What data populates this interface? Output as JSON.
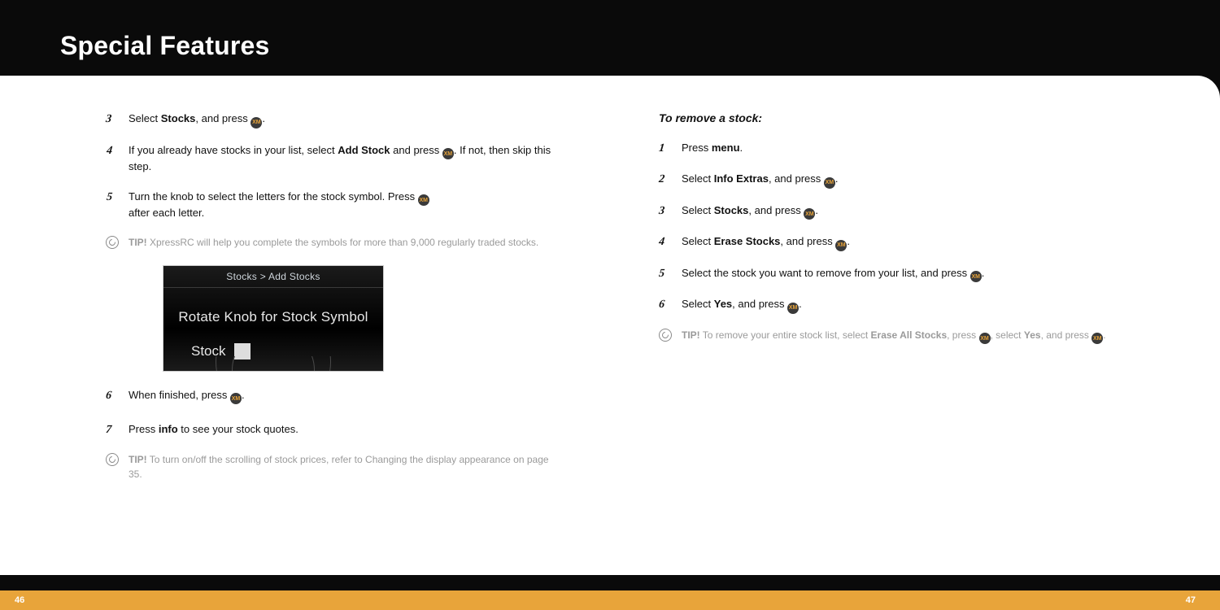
{
  "header": {
    "title": "Special Features"
  },
  "left": {
    "steps": {
      "s3": {
        "num": "3",
        "pre": "Select ",
        "bold": "Stocks",
        "post": ", and press "
      },
      "s4": {
        "num": "4",
        "pre": "If you already have stocks in your list, select ",
        "bold": "Add Stock",
        "post": " and press ",
        "tail": ". If not, then skip this step."
      },
      "s5": {
        "num": "5",
        "line1": "Turn the knob to select the letters for the stock symbol. Press ",
        "line2": "after each letter."
      },
      "s6": {
        "num": "6",
        "pre": "When finished, press "
      },
      "s7": {
        "num": "7",
        "pre": "Press ",
        "bold": "info",
        "post": " to see your stock quotes."
      }
    },
    "tip1": {
      "label": "TIP!",
      "text": " XpressRC will help you complete the symbols for more than 9,000 regularly traded stocks."
    },
    "tip2": {
      "label": "TIP!",
      "text": " To turn on/off the scrolling of stock prices, refer to Changing the display appearance on page 35."
    },
    "screenshot": {
      "title": "Stocks > Add Stocks",
      "main": "Rotate Knob for Stock Symbol",
      "stock_label": "Stock"
    }
  },
  "right": {
    "subhead": "To remove a stock:",
    "steps": {
      "s1": {
        "num": "1",
        "pre": "Press ",
        "bold": "menu",
        "post": "."
      },
      "s2": {
        "num": "2",
        "pre": "Select ",
        "bold": "Info Extras",
        "post": ", and press "
      },
      "s3": {
        "num": "3",
        "pre": "Select ",
        "bold": "Stocks",
        "post": ", and press "
      },
      "s4": {
        "num": "4",
        "pre": "Select ",
        "bold": "Erase Stocks",
        "post": ", and press "
      },
      "s5": {
        "num": "5",
        "text": "Select the stock you want to remove from your list, and press "
      },
      "s6": {
        "num": "6",
        "pre": "Select ",
        "bold": "Yes",
        "post": ", and press "
      }
    },
    "tip": {
      "label": "TIP!",
      "t1": " To remove your entire stock list, select ",
      "b1": "Erase All Stocks",
      "t2": ", press ",
      "t3": ", select ",
      "b2": "Yes",
      "t4": ", and press "
    }
  },
  "footer": {
    "left": "46",
    "right": "47"
  },
  "btn": {
    "xm": "XM"
  }
}
